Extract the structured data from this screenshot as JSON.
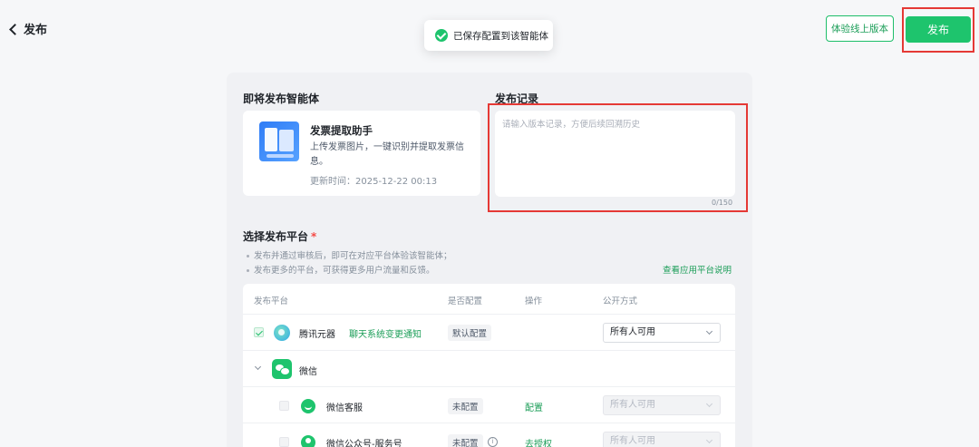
{
  "header": {
    "back_label": "发布",
    "trial_button": "体验线上版本",
    "publish_button": "发布",
    "toast": "已保存配置到该智能体",
    "accent_color": "#1ec46d"
  },
  "agent_section": {
    "title": "即将发布智能体",
    "name": "发票提取助手",
    "description": "上传发票图片，一键识别并提取发票信息。",
    "updated": "更新时间：2025-12-22 00:13"
  },
  "record_section": {
    "title": "发布记录",
    "placeholder": "请输入版本记录，方便后续回溯历史",
    "counter": "0/150"
  },
  "platform_section": {
    "title": "选择发布平台",
    "required_mark": "*",
    "notes": [
      "发布并通过审核后，即可在对应平台体验该智能体；",
      "发布更多的平台，可获得更多用户流量和反馈。"
    ],
    "docs_link": "查看应用平台说明",
    "columns": [
      "发布平台",
      "是否配置",
      "操作",
      "公开方式"
    ],
    "rows": [
      {
        "name": "腾讯元器",
        "notice": "聊天系统变更通知",
        "config": "默认配置",
        "action": "",
        "visibility": "所有人可用",
        "checked": true
      },
      {
        "name": "微信",
        "group": true
      },
      {
        "name": "微信客服",
        "config": "未配置",
        "action": "配置",
        "visibility": "所有人可用",
        "checked": false
      },
      {
        "name": "微信公众号-服务号",
        "config": "未配置",
        "action": "去授权",
        "visibility": "所有人可用",
        "checked": false
      }
    ]
  }
}
